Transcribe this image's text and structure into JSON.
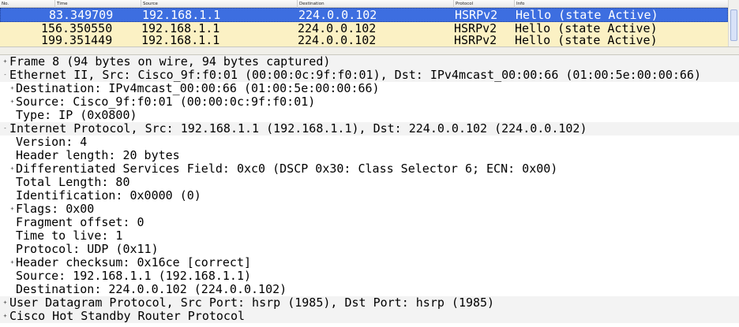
{
  "packet_list": {
    "headers": {
      "no": "No.",
      "time": "Time",
      "source": "Source",
      "destination": "Destination",
      "protocol": "Protocol",
      "info": "Info"
    },
    "rows": [
      {
        "no": "8",
        "time": "3.349709",
        "source": "192.168.1.1",
        "destination": "224.0.0.102",
        "protocol": "HSRPv2",
        "info": "Hello (state Active)"
      },
      {
        "no": "15",
        "time": "6.350550",
        "source": "192.168.1.1",
        "destination": "224.0.0.102",
        "protocol": "HSRPv2",
        "info": "Hello (state Active)"
      },
      {
        "no": "19",
        "time": "9.351449",
        "source": "192.168.1.1",
        "destination": "224.0.0.102",
        "protocol": "HSRPv2",
        "info": "Hello (state Active)"
      }
    ]
  },
  "tree": [
    {
      "text": "Frame 8 (94 bytes on wire, 94 bytes captured)",
      "level": 0,
      "expander": "+"
    },
    {
      "text": "Ethernet II, Src: Cisco_9f:f0:01 (00:00:0c:9f:f0:01), Dst: IPv4mcast_00:00:66 (01:00:5e:00:00:66)",
      "level": 0,
      "expander": "-"
    },
    {
      "text": "Destination: IPv4mcast_00:00:66 (01:00:5e:00:00:66)",
      "level": 1,
      "expander": "+"
    },
    {
      "text": "Source: Cisco_9f:f0:01 (00:00:0c:9f:f0:01)",
      "level": 1,
      "expander": "+"
    },
    {
      "text": "Type: IP (0x0800)",
      "level": 1,
      "expander": ""
    },
    {
      "text": "Internet Protocol, Src: 192.168.1.1 (192.168.1.1), Dst: 224.0.0.102 (224.0.0.102)",
      "level": 0,
      "expander": "-"
    },
    {
      "text": "Version: 4",
      "level": 1,
      "expander": ""
    },
    {
      "text": "Header length: 20 bytes",
      "level": 1,
      "expander": ""
    },
    {
      "text": "Differentiated Services Field: 0xc0 (DSCP 0x30: Class Selector 6; ECN: 0x00)",
      "level": 1,
      "expander": "+"
    },
    {
      "text": "Total Length: 80",
      "level": 1,
      "expander": ""
    },
    {
      "text": "Identification: 0x0000 (0)",
      "level": 1,
      "expander": ""
    },
    {
      "text": "Flags: 0x00",
      "level": 1,
      "expander": "+"
    },
    {
      "text": "Fragment offset: 0",
      "level": 1,
      "expander": ""
    },
    {
      "text": "Time to live: 1",
      "level": 1,
      "expander": ""
    },
    {
      "text": "Protocol: UDP (0x11)",
      "level": 1,
      "expander": ""
    },
    {
      "text": "Header checksum: 0x16ce [correct]",
      "level": 1,
      "expander": "+"
    },
    {
      "text": "Source: 192.168.1.1 (192.168.1.1)",
      "level": 1,
      "expander": ""
    },
    {
      "text": "Destination: 224.0.0.102 (224.0.0.102)",
      "level": 1,
      "expander": ""
    },
    {
      "text": "User Datagram Protocol, Src Port: hsrp (1985), Dst Port: hsrp (1985)",
      "level": 0,
      "expander": "+"
    },
    {
      "text": "Cisco Hot Standby Router Protocol",
      "level": 0,
      "expander": "+"
    }
  ]
}
